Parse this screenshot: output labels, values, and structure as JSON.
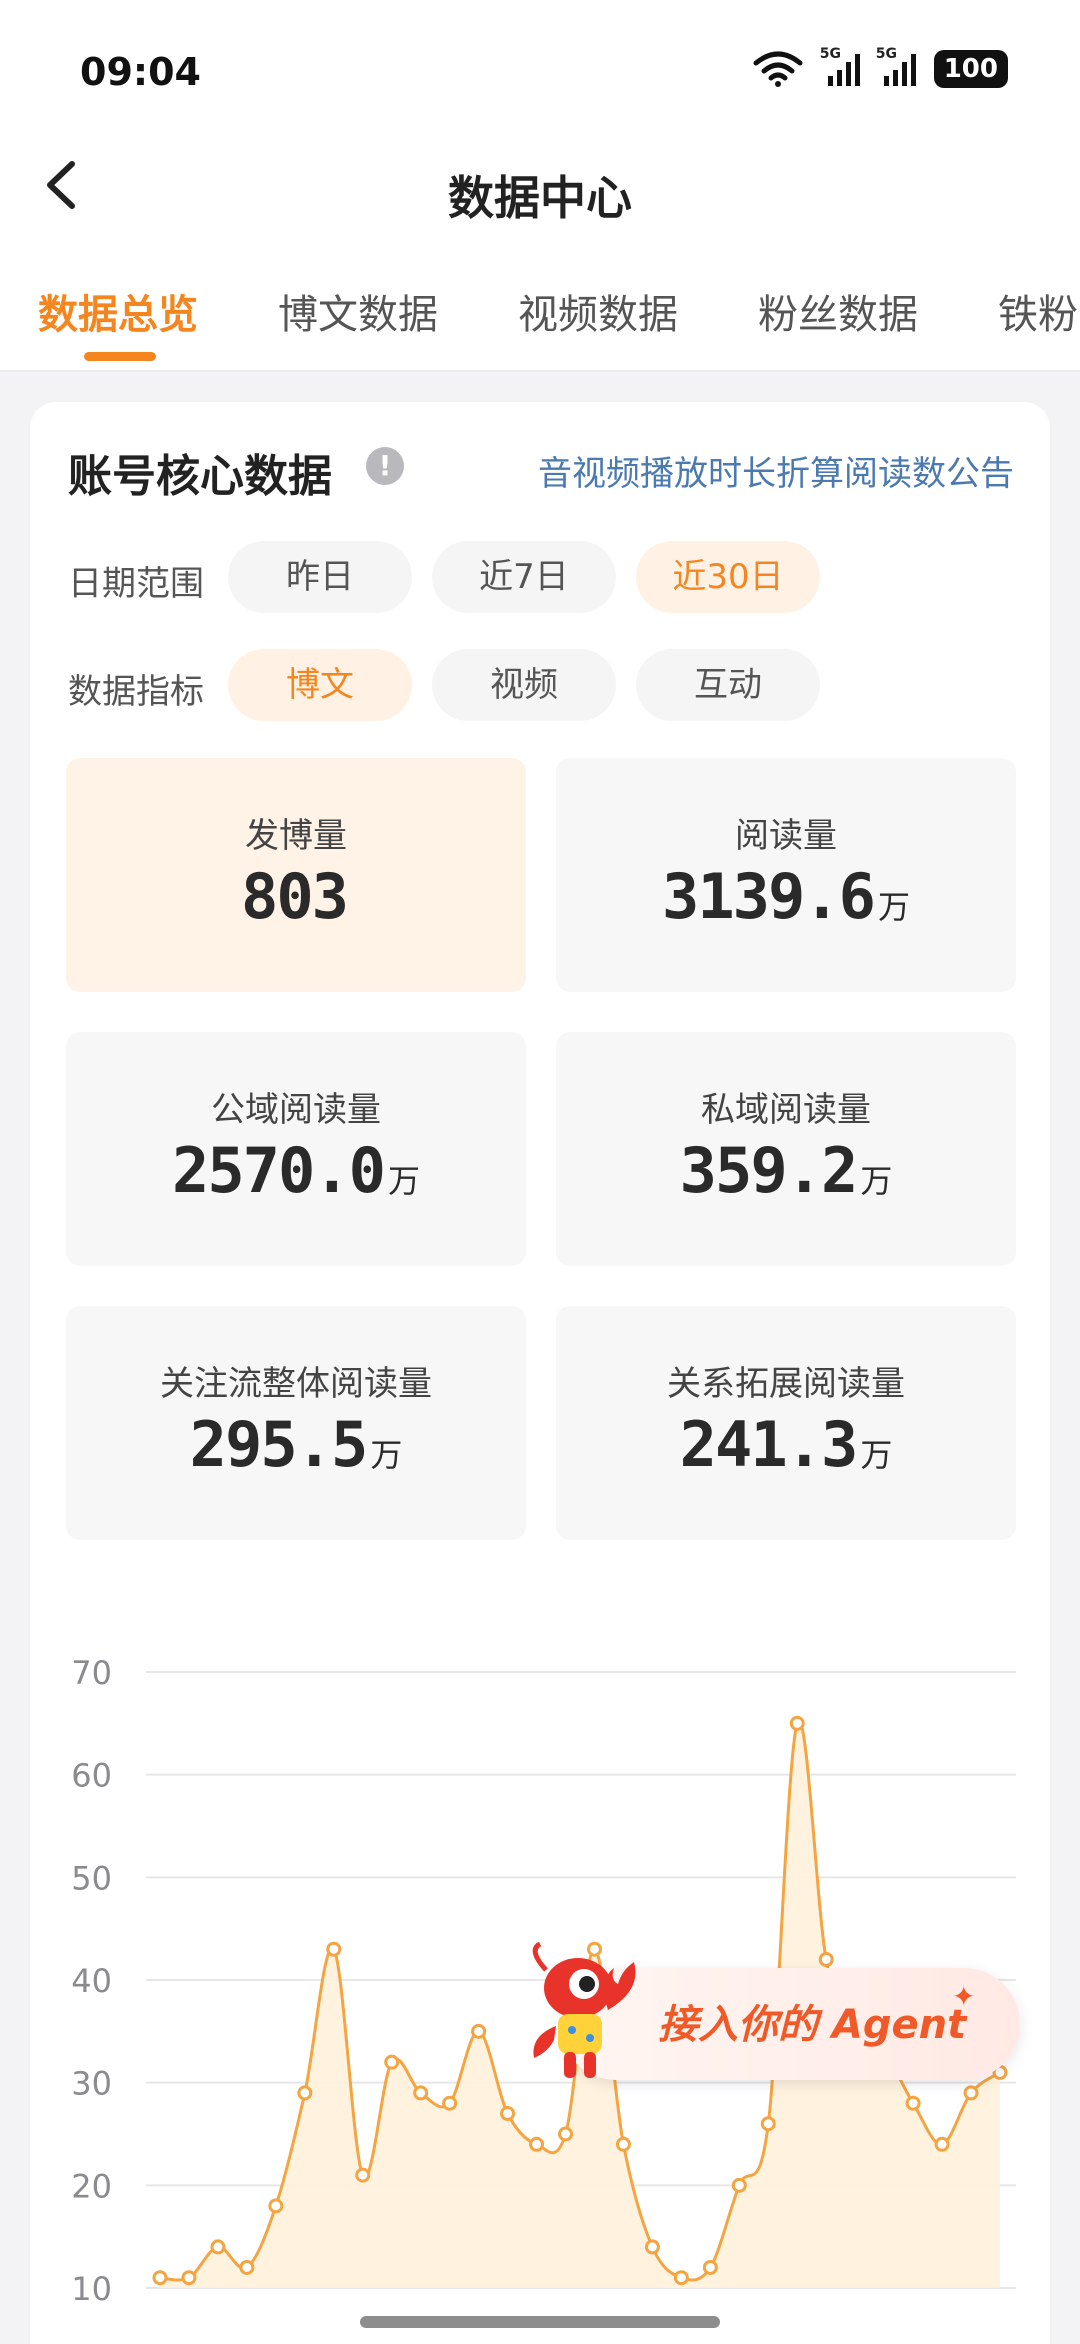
{
  "status_bar": {
    "time": "09:04",
    "signal_1": "5G",
    "signal_2": "5G",
    "battery": "100"
  },
  "header": {
    "title": "数据中心"
  },
  "tabs": [
    {
      "label": "数据总览"
    },
    {
      "label": "博文数据"
    },
    {
      "label": "视频数据"
    },
    {
      "label": "粉丝数据"
    },
    {
      "label": "铁粉"
    }
  ],
  "core": {
    "title": "账号核心数据",
    "info_icon": "!",
    "notice_link": "音视频播放时长折算阅读数公告",
    "date_range_label": "日期范围",
    "date_options": [
      "昨日",
      "近7日",
      "近30日"
    ],
    "metric_label": "数据指标",
    "metric_options": [
      "博文",
      "视频",
      "互动"
    ]
  },
  "metrics": [
    {
      "label": "发博量",
      "value": "803",
      "unit": ""
    },
    {
      "label": "阅读量",
      "value": "3139.6",
      "unit": "万"
    },
    {
      "label": "公域阅读量",
      "value": "2570.0",
      "unit": "万"
    },
    {
      "label": "私域阅读量",
      "value": "359.2",
      "unit": "万"
    },
    {
      "label": "关注流整体阅读量",
      "value": "295.5",
      "unit": "万"
    },
    {
      "label": "关系拓展阅读量",
      "value": "241.3",
      "unit": "万"
    }
  ],
  "agent_banner": {
    "text": "接入你的 Agent",
    "sparkle": "✦"
  },
  "colors": {
    "accent": "#f5861f",
    "link": "#4a7ab0",
    "chart_line": "#f5a442",
    "chart_fill": "#fff1dc"
  },
  "chart_data": {
    "type": "area",
    "ylim": [
      10,
      70
    ],
    "y_ticks": [
      "70",
      "60",
      "50",
      "40",
      "30",
      "20",
      "10"
    ],
    "y_tick_values": [
      70,
      60,
      50,
      40,
      30,
      20,
      10
    ],
    "values": [
      11,
      11,
      14,
      12,
      18,
      29,
      43,
      21,
      32,
      29,
      28,
      35,
      27,
      24,
      25,
      43,
      24,
      14,
      11,
      12,
      20,
      26,
      65,
      42,
      35,
      33,
      28,
      24,
      29,
      31
    ],
    "grid": true
  }
}
